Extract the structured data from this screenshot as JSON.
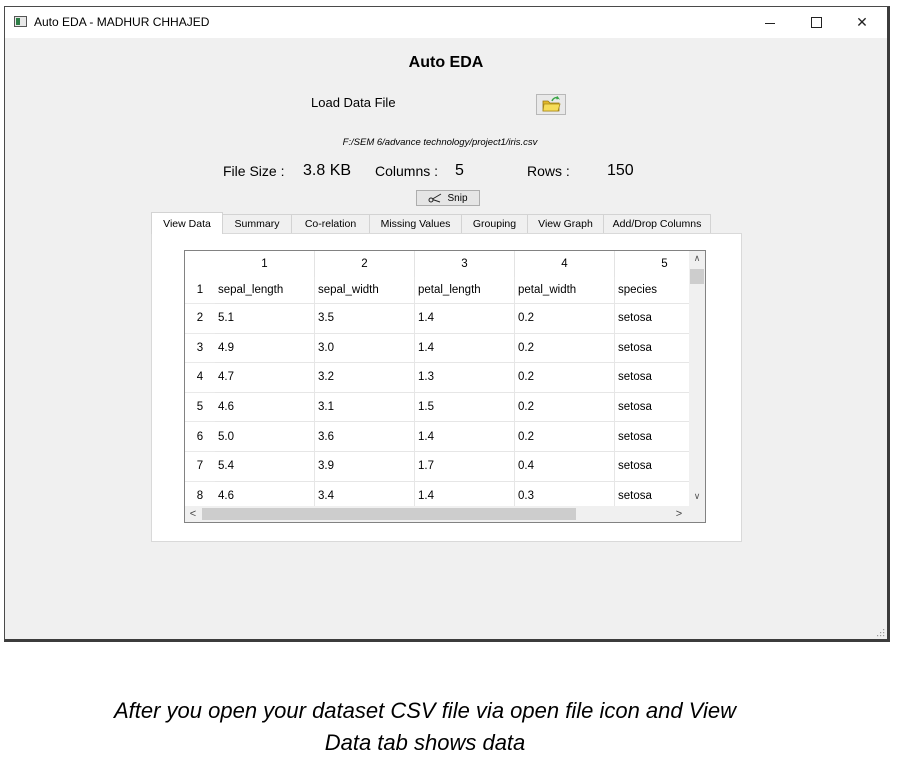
{
  "window": {
    "title": "Auto EDA - MADHUR CHHAJED",
    "minimize_glyph": "",
    "close_glyph": "✕"
  },
  "app": {
    "heading": "Auto EDA",
    "load_label": "Load Data File",
    "file_path": "F:/SEM 6/advance technology/project1/iris.csv",
    "stats": {
      "file_size_label": "File Size :",
      "file_size_value": "3.8 KB",
      "columns_label": "Columns :",
      "columns_value": "5",
      "rows_label": "Rows :",
      "rows_value": "150"
    },
    "snip_label": "Snip"
  },
  "tabs": [
    "View Data",
    "Summary",
    "Co-relation",
    "Missing Values",
    "Grouping",
    "View Graph",
    "Add/Drop Columns"
  ],
  "table": {
    "column_headers": [
      "1",
      "2",
      "3",
      "4",
      "5"
    ],
    "row_headers": [
      "1",
      "2",
      "3",
      "4",
      "5",
      "6",
      "7",
      "8"
    ],
    "rows": [
      [
        "sepal_length",
        "sepal_width",
        "petal_length",
        "petal_width",
        "species"
      ],
      [
        "5.1",
        "3.5",
        "1.4",
        "0.2",
        "setosa"
      ],
      [
        "4.9",
        "3.0",
        "1.4",
        "0.2",
        "setosa"
      ],
      [
        "4.7",
        "3.2",
        "1.3",
        "0.2",
        "setosa"
      ],
      [
        "4.6",
        "3.1",
        "1.5",
        "0.2",
        "setosa"
      ],
      [
        "5.0",
        "3.6",
        "1.4",
        "0.2",
        "setosa"
      ],
      [
        "5.4",
        "3.9",
        "1.7",
        "0.4",
        "setosa"
      ],
      [
        "4.6",
        "3.4",
        "1.4",
        "0.3",
        "setosa"
      ]
    ],
    "scroll_glyphs": {
      "up": "∧",
      "down": "∨",
      "left": "<",
      "right": ">"
    }
  },
  "caption": {
    "line1": "After you open your dataset CSV file via open file icon and View",
    "line2": "Data tab shows data"
  },
  "colors": {
    "window_bg": "#f0f0f0",
    "folder_yellow": "#f2d23c",
    "folder_green": "#3aa648"
  }
}
